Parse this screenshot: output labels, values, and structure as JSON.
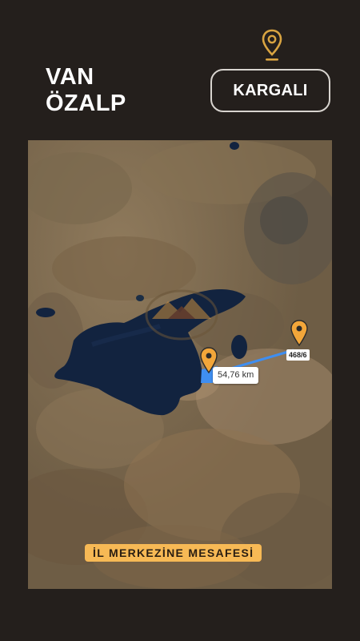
{
  "header": {
    "province": "VAN",
    "district": "ÖZALP",
    "destination_button": "KARGALI"
  },
  "map": {
    "distance_label": "54,76 km",
    "parcel_label": "468/6",
    "caption": "İL MERKEZİNE MESAFESİ",
    "route_color": "#3f8ef0",
    "pin_color": "#f2a63a",
    "icons": [
      "location-pin-icon",
      "map-pin-icon"
    ]
  },
  "theme": {
    "background": "#241f1c",
    "accent": "#f7b955",
    "button_border": "#d8d4cf"
  }
}
